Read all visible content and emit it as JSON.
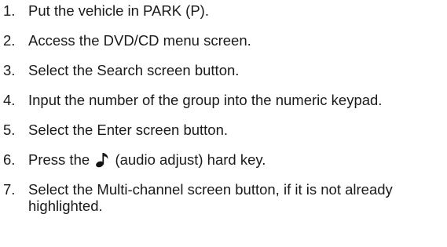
{
  "steps": [
    {
      "number": "1.",
      "text": "Put the vehicle in PARK (P)."
    },
    {
      "number": "2.",
      "text": "Access the DVD/CD menu screen."
    },
    {
      "number": "3.",
      "text": "Select the Search screen button."
    },
    {
      "number": "4.",
      "text": "Input the number of the group into the numeric keypad."
    },
    {
      "number": "5.",
      "text": "Select the Enter screen button."
    },
    {
      "number": "6.",
      "text_before": "Press the",
      "icon": "music-note-icon",
      "text_after": "(audio adjust) hard key."
    },
    {
      "number": "7.",
      "text": "Select the Multi-channel screen button, if it is not already highlighted."
    }
  ]
}
